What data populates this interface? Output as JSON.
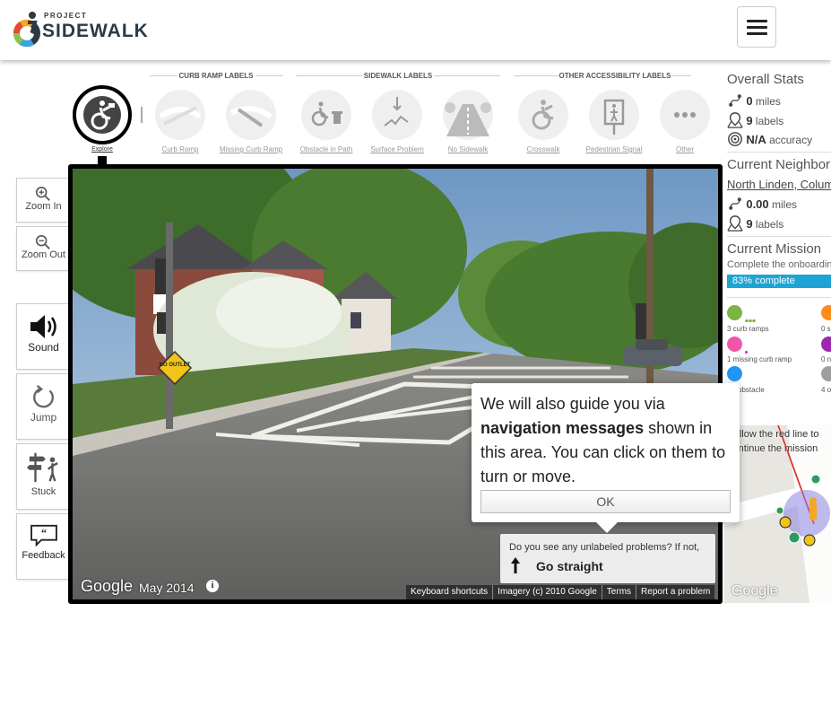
{
  "header": {
    "logo_project": "PROJECT",
    "logo_sidewalk": "SIDEWALK"
  },
  "toolbar": {
    "explore_label": "Explore",
    "groups": [
      {
        "title": "CURB RAMP LABELS"
      },
      {
        "title": "SIDEWALK LABELS"
      },
      {
        "title": "OTHER ACCESSIBILITY LABELS"
      }
    ],
    "tools": [
      {
        "label": "Curb Ramp",
        "icon": "curb-ramp-icon"
      },
      {
        "label": "Missing Curb Ramp",
        "icon": "missing-curb-ramp-icon"
      },
      {
        "label": "Obstacle in Path",
        "icon": "obstacle-icon"
      },
      {
        "label": "Surface Problem",
        "icon": "surface-problem-icon"
      },
      {
        "label": "No Sidewalk",
        "icon": "no-sidewalk-icon"
      },
      {
        "label": "Crosswalk",
        "icon": "crosswalk-icon"
      },
      {
        "label": "Pedestrian Signal",
        "icon": "pedestrian-signal-icon"
      },
      {
        "label": "Other",
        "icon": "other-icon"
      }
    ]
  },
  "sidebar": {
    "zoom_in": "Zoom In",
    "zoom_out": "Zoom Out",
    "sound": "Sound",
    "jump": "Jump",
    "stuck": "Stuck",
    "feedback": "Feedback"
  },
  "streetview": {
    "sign_text": "NO OUTLET",
    "google": "Google",
    "date": "May 2014",
    "footer": [
      "Keyboard shortcuts",
      "Imagery (c) 2010 Google",
      "Terms",
      "Report a problem"
    ]
  },
  "popup": {
    "text_pre": "We will also guide you via ",
    "text_bold": "navigation messages",
    "text_post": " shown in this area. You can click on them to turn or move.",
    "ok": "OK"
  },
  "nav_message": {
    "question": "Do you see any unlabeled problems? If not,",
    "action": "Go straight"
  },
  "stats": {
    "overall_title": "Overall Stats",
    "overall_miles": "0",
    "overall_miles_unit": "miles",
    "overall_labels": "9",
    "overall_labels_unit": "labels",
    "overall_accuracy": "N/A",
    "overall_accuracy_unit": "accuracy",
    "neighborhood_title": "Current Neighborhood",
    "neighborhood_name": "North Linden, Columbus",
    "neighborhood_miles": "0.00",
    "neighborhood_miles_unit": "miles",
    "neighborhood_labels": "9",
    "neighborhood_labels_unit": "labels",
    "mission_title": "Current Mission",
    "mission_desc": "Complete the onboarding",
    "mission_progress_text": "83% complete",
    "mission_progress": 0.83,
    "label_counts": [
      {
        "text": "3 curb ramps",
        "color": "#7cb342"
      },
      {
        "text": "1 missing curb ramp",
        "color": "#e91e8c"
      },
      {
        "text": "obstacle",
        "color": "#2196f3"
      }
    ],
    "label_counts_right": [
      {
        "text": "0 s",
        "color": "#ff8c1a"
      },
      {
        "text": "0 n",
        "color": "#9c27b0"
      },
      {
        "text": "4 o",
        "color": "#9e9e9e"
      }
    ]
  },
  "minimap": {
    "instruction": "Follow the red line to continue the mission",
    "google": "Google"
  },
  "colors": {
    "accent": "#1ea4d3",
    "dark": "#2b3a45"
  }
}
